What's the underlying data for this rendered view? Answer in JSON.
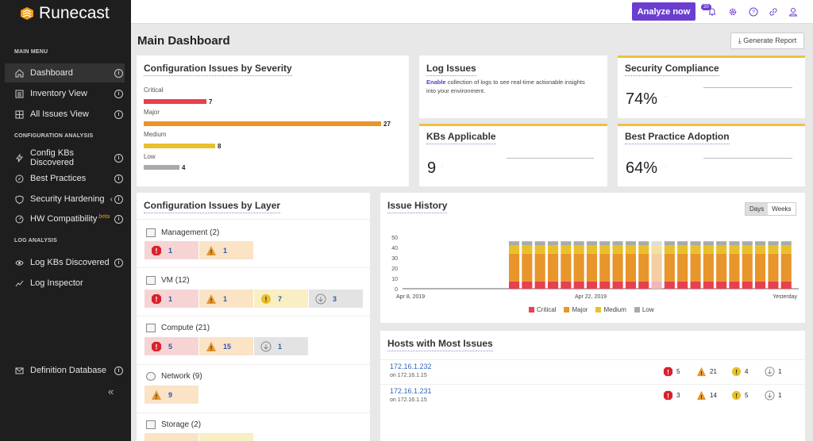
{
  "brand": {
    "name": "Runecast"
  },
  "sidebar": {
    "sections": {
      "main": "MAIN MENU",
      "config": "CONFIGURATION ANALYSIS",
      "log": "LOG ANALYSIS"
    },
    "items": [
      {
        "label": "Dashboard"
      },
      {
        "label": "Inventory View"
      },
      {
        "label": "All Issues View"
      },
      {
        "label": "Config KBs Discovered"
      },
      {
        "label": "Best Practices"
      },
      {
        "label": "Security Hardening"
      },
      {
        "label": "HW Compatibility",
        "badge": "beta"
      },
      {
        "label": "Log KBs Discovered"
      },
      {
        "label": "Log Inspector"
      },
      {
        "label": "Definition Database"
      }
    ],
    "collapse": "«"
  },
  "topbar": {
    "analyze_label": "Analyze now",
    "notification_count": "20"
  },
  "main": {
    "title": "Main Dashboard",
    "generate_report": "Generate Report"
  },
  "severity_card": {
    "title": "Configuration Issues by Severity",
    "rows": [
      {
        "label": "Critical",
        "value": "7",
        "color": "#e8404e"
      },
      {
        "label": "Major",
        "value": "27",
        "color": "#e8952b"
      },
      {
        "label": "Medium",
        "value": "8",
        "color": "#e8c02b"
      },
      {
        "label": "Low",
        "value": "4",
        "color": "#aaaaaa"
      }
    ]
  },
  "log_issues": {
    "title": "Log Issues",
    "link": "Enable",
    "text": "collection of logs to see real-time actionable insights into your environment."
  },
  "security": {
    "title": "Security Compliance",
    "value": "74%"
  },
  "kbs": {
    "title": "KBs Applicable",
    "value": "9"
  },
  "best_practice": {
    "title": "Best Practice Adoption",
    "value": "64%"
  },
  "layer_card": {
    "title": "Configuration Issues by Layer",
    "layers": [
      {
        "name": "Management (2)",
        "crit": "1",
        "maj": "1"
      },
      {
        "name": "VM (12)",
        "crit": "1",
        "maj": "1",
        "med": "7",
        "low": "3"
      },
      {
        "name": "Compute (21)",
        "crit": "5",
        "maj": "15",
        "low": "1"
      },
      {
        "name": "Network (9)",
        "maj": "9"
      },
      {
        "name": "Storage (2)"
      }
    ]
  },
  "history": {
    "title": "Issue History",
    "toggle": [
      "Days",
      "Weeks"
    ],
    "x_labels": [
      "Apr 8, 2019",
      "Apr 22, 2019",
      "Yesterday"
    ],
    "legend": [
      {
        "label": "Critical",
        "color": "#e8404e"
      },
      {
        "label": "Major",
        "color": "#e8952b"
      },
      {
        "label": "Medium",
        "color": "#e8c02b"
      },
      {
        "label": "Low",
        "color": "#aaaaaa"
      }
    ]
  },
  "chart_data": {
    "type": "bar",
    "stacked": true,
    "ylim": [
      0,
      50
    ],
    "yticks": [
      "0",
      "10",
      "20",
      "30",
      "40",
      "50"
    ],
    "series": [
      {
        "name": "Critical",
        "values": [
          7,
          7,
          7,
          7,
          7,
          7,
          7,
          7,
          7,
          7,
          7,
          7,
          7,
          7,
          7,
          7,
          7,
          7,
          7,
          7,
          7,
          7
        ]
      },
      {
        "name": "Major",
        "values": [
          27,
          27,
          27,
          27,
          27,
          27,
          27,
          27,
          27,
          27,
          27,
          27,
          27,
          27,
          27,
          27,
          27,
          27,
          27,
          27,
          27,
          27
        ]
      },
      {
        "name": "Medium",
        "values": [
          8,
          8,
          8,
          8,
          8,
          8,
          8,
          8,
          8,
          8,
          8,
          8,
          8,
          8,
          8,
          8,
          8,
          8,
          8,
          8,
          8,
          8
        ]
      },
      {
        "name": "Low",
        "values": [
          4,
          4,
          4,
          4,
          4,
          4,
          4,
          4,
          4,
          4,
          4,
          4,
          4,
          4,
          4,
          4,
          4,
          4,
          4,
          4,
          4,
          4
        ]
      }
    ]
  },
  "hosts": {
    "title": "Hosts with Most Issues",
    "rows": [
      {
        "name": "172.16.1.232",
        "on": "on 172.16.1.15",
        "crit": "5",
        "maj": "21",
        "med": "4",
        "low": "1"
      },
      {
        "name": "172.16.1.231",
        "on": "on 172.16.1.15",
        "crit": "3",
        "maj": "14",
        "med": "5",
        "low": "1"
      }
    ]
  }
}
